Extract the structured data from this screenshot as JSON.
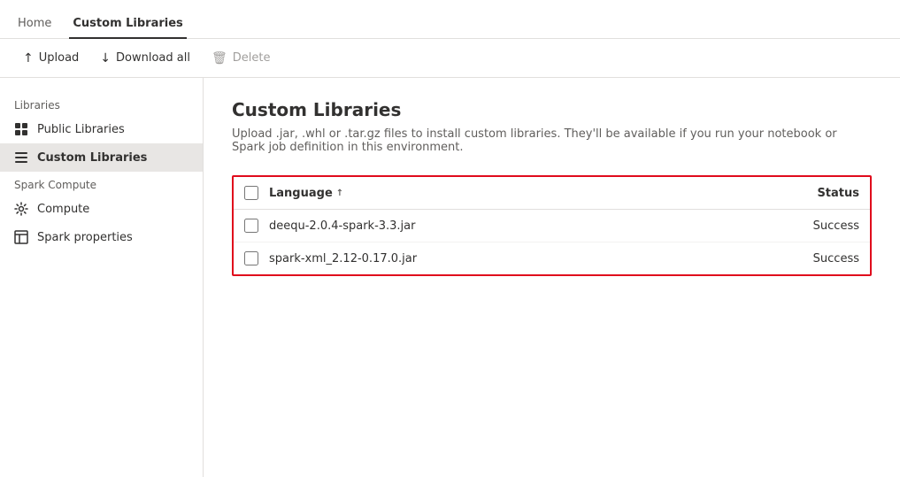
{
  "topnav": {
    "items": [
      {
        "label": "Home",
        "active": false
      },
      {
        "label": "Custom Libraries",
        "active": true
      }
    ]
  },
  "toolbar": {
    "upload_label": "Upload",
    "download_label": "Download all",
    "delete_label": "Delete",
    "upload_icon": "↑",
    "download_icon": "↓",
    "delete_icon": "🗑"
  },
  "sidebar": {
    "libraries_section": "Libraries",
    "spark_section": "Spark Compute",
    "items": [
      {
        "label": "Public Libraries",
        "icon": "grid",
        "active": false,
        "id": "public-libraries"
      },
      {
        "label": "Custom Libraries",
        "icon": "bars",
        "active": true,
        "id": "custom-libraries"
      },
      {
        "label": "Compute",
        "icon": "gear",
        "active": false,
        "id": "compute"
      },
      {
        "label": "Spark properties",
        "icon": "table",
        "active": false,
        "id": "spark-properties"
      }
    ]
  },
  "content": {
    "title": "Custom Libraries",
    "description": "Upload .jar, .whl or .tar.gz files to install custom libraries. They'll be available if you run your notebook or Spark job definition in this environment.",
    "table": {
      "col_language": "Language",
      "sort_icon": "↑",
      "col_status": "Status",
      "rows": [
        {
          "filename": "deequ-2.0.4-spark-3.3.jar",
          "status": "Success"
        },
        {
          "filename": "spark-xml_2.12-0.17.0.jar",
          "status": "Success"
        }
      ]
    }
  }
}
